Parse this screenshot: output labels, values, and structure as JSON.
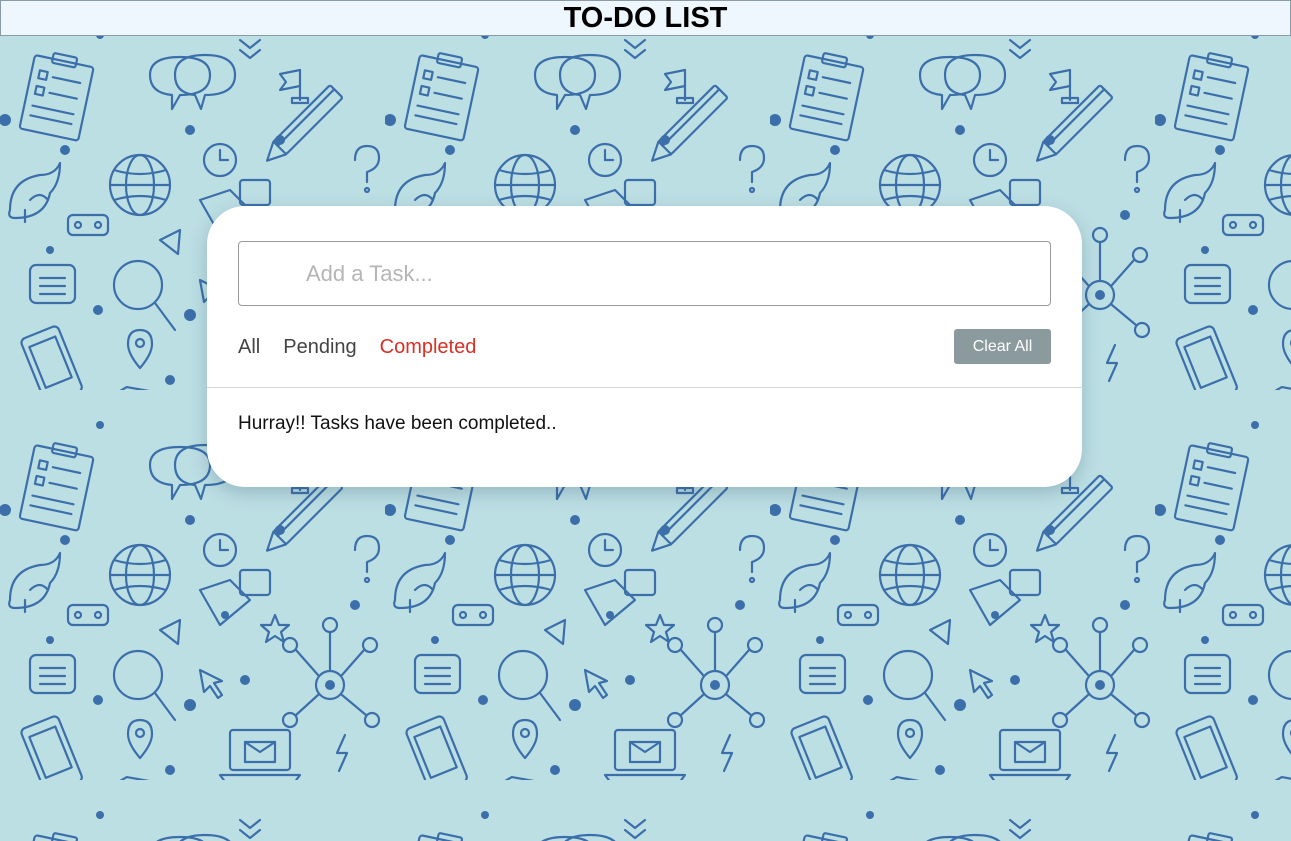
{
  "header": {
    "title": "TO-DO LIST"
  },
  "input": {
    "placeholder": "Add a Task...",
    "value": ""
  },
  "filters": [
    {
      "label": "All",
      "active": false
    },
    {
      "label": "Pending",
      "active": false
    },
    {
      "label": "Completed",
      "active": true
    }
  ],
  "clear_button": {
    "label": "Clear All"
  },
  "task_message": "Hurray!! Tasks have been completed..",
  "colors": {
    "page_background": "#bcdfe4",
    "pattern_stroke": "#3c6faa",
    "header_background": "#eef6fe",
    "active_filter": "#d93025",
    "clear_button": "#8b9a9c"
  }
}
